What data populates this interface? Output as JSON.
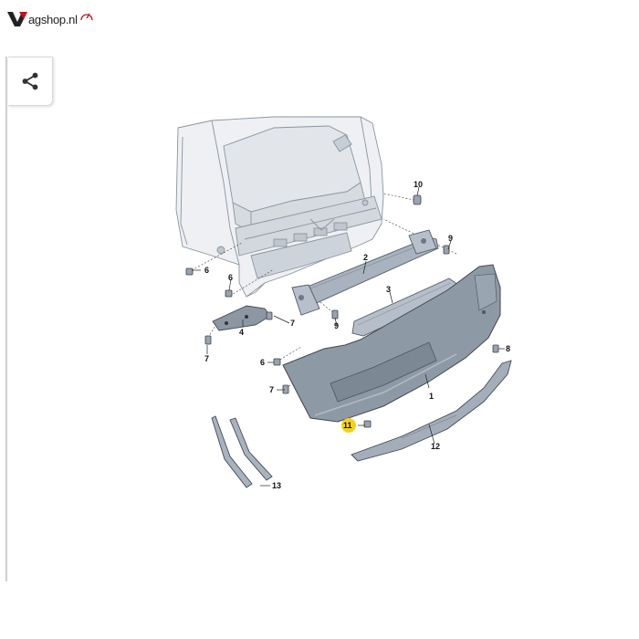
{
  "brand": {
    "name": "vagshop.nl",
    "logo_initial": "V",
    "logo_rest": "agshop.nl",
    "accent": "#c0141b"
  },
  "toolbar": {
    "share_icon": "share-icon"
  },
  "diagram": {
    "highlight_color": "#f4d21c",
    "callouts": [
      {
        "id": "c1",
        "label": "1"
      },
      {
        "id": "c2",
        "label": "2"
      },
      {
        "id": "c3",
        "label": "3"
      },
      {
        "id": "c4",
        "label": "4"
      },
      {
        "id": "c6a",
        "label": "6"
      },
      {
        "id": "c6b",
        "label": "6"
      },
      {
        "id": "c6c",
        "label": "6"
      },
      {
        "id": "c7a",
        "label": "7"
      },
      {
        "id": "c7b",
        "label": "7"
      },
      {
        "id": "c7c",
        "label": "7"
      },
      {
        "id": "c8",
        "label": "8"
      },
      {
        "id": "c9a",
        "label": "9"
      },
      {
        "id": "c9b",
        "label": "9"
      },
      {
        "id": "c10",
        "label": "10"
      },
      {
        "id": "c11",
        "label": "11",
        "highlighted": true
      },
      {
        "id": "c12",
        "label": "12"
      },
      {
        "id": "c13",
        "label": "13"
      }
    ]
  }
}
